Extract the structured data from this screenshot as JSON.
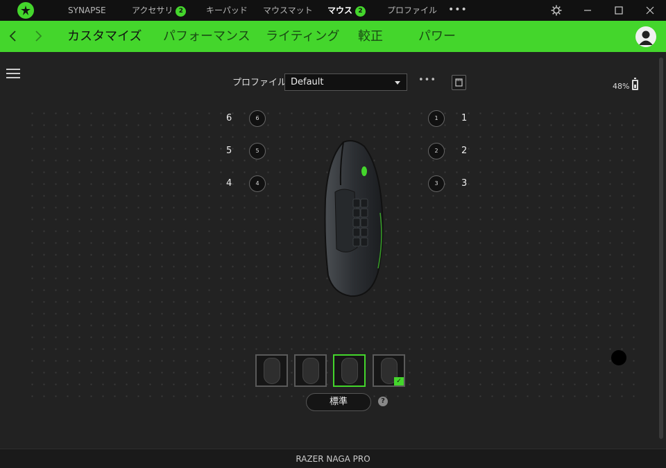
{
  "titlebar": {
    "tabs": [
      {
        "label": "SYNAPSE"
      },
      {
        "label": "アクセサリ",
        "badge": "2"
      },
      {
        "label": "キーパッド"
      },
      {
        "label": "マウスマット"
      },
      {
        "label": "マウス",
        "badge": "2"
      },
      {
        "label": "プロファイル"
      }
    ],
    "more": "•••"
  },
  "subnav": {
    "tabs": [
      "カスタマイズ",
      "パフォーマンス",
      "ライティング",
      "較正",
      "パワー"
    ]
  },
  "profile": {
    "label": "プロファイル",
    "selected": "Default",
    "more": "•••"
  },
  "battery": {
    "text": "48%"
  },
  "buttons": {
    "left": [
      {
        "num": "6",
        "circle": "6"
      },
      {
        "num": "5",
        "circle": "5"
      },
      {
        "num": "4",
        "circle": "4"
      }
    ],
    "right": [
      {
        "num": "1",
        "circle": "1"
      },
      {
        "num": "2",
        "circle": "2"
      },
      {
        "num": "3",
        "circle": "3"
      }
    ]
  },
  "standard_button": "標準",
  "help": "?",
  "footer": {
    "device": "RAZER NAGA PRO"
  },
  "colors": {
    "accent": "#44d62c",
    "background": "#222222",
    "titlebar": "#111111"
  }
}
